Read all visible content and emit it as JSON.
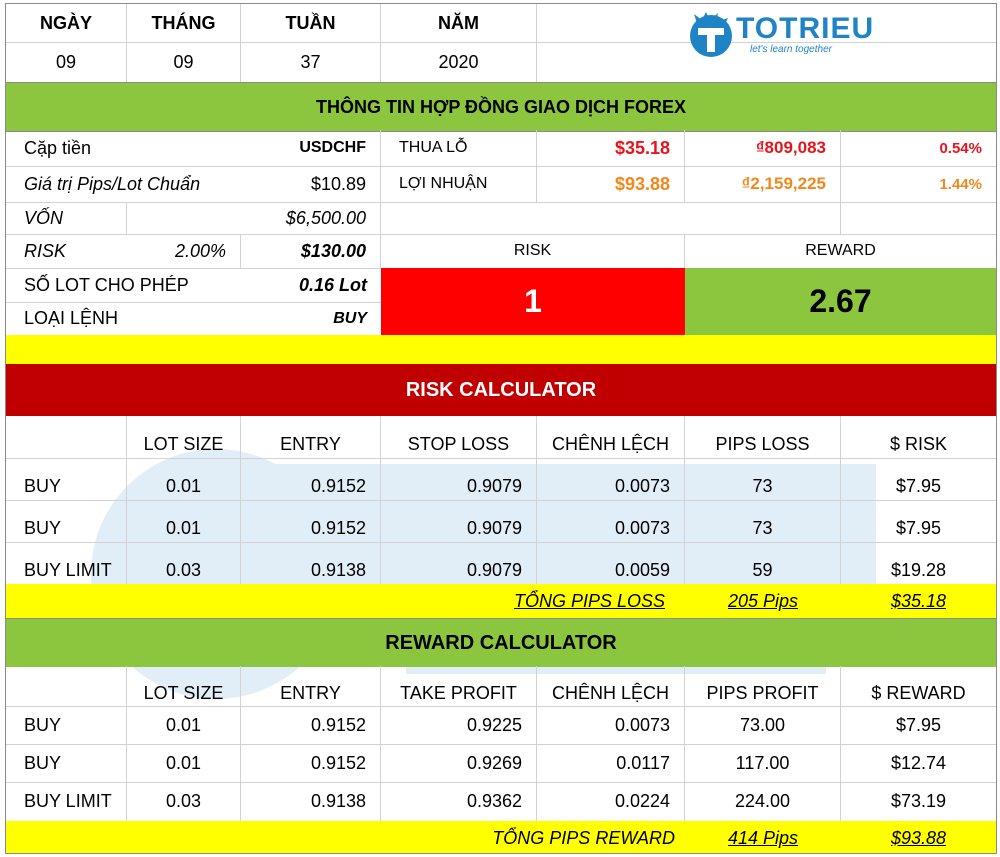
{
  "date_header": {
    "labels": [
      "NGÀY",
      "THÁNG",
      "TUẦN",
      "NĂM"
    ],
    "values": [
      "09",
      "09",
      "37",
      "2020"
    ]
  },
  "logo": {
    "name": "TOTRIEU",
    "tagline": "let's learn together",
    "icon": "totrieu-t-logo-icon",
    "color": "#1f84c6"
  },
  "contract_title": "THÔNG TIN HỢP ĐỒNG GIAO DỊCH FOREX",
  "contract": {
    "pair_label": "Cặp tiền",
    "pair_value": "USDCHF",
    "pip_label": "Giá trị Pips/Lot Chuẩn",
    "pip_value": "$10.89",
    "capital_label": "VỐN",
    "capital_value": "$6,500.00",
    "risk_label": "RISK",
    "risk_pct": "2.00%",
    "risk_value": "$130.00",
    "lot_label": "SỐ LOT CHO PHÉP",
    "lot_value": "0.16 Lot",
    "order_label": "LOẠI LỆNH",
    "order_value": "BUY",
    "loss_label": "THUA LỖ",
    "loss_usd": "$35.18",
    "loss_vnd": "₫809,083",
    "loss_pct": "0.54%",
    "profit_label": "LỢI NHUẬN",
    "profit_usd": "$93.88",
    "profit_vnd": "₫2,159,225",
    "profit_pct": "1.44%",
    "rr_risk_label": "RISK",
    "rr_reward_label": "REWARD",
    "rr_risk_value": "1",
    "rr_reward_value": "2.67"
  },
  "risk_calc": {
    "title": "RISK CALCULATOR",
    "headers": [
      "",
      "LOT SIZE",
      "ENTRY",
      "STOP LOSS",
      "CHÊNH LỆCH",
      "PIPS LOSS",
      "$ RISK"
    ],
    "rows": [
      [
        "BUY",
        "0.01",
        "0.9152",
        "0.9079",
        "0.0073",
        "73",
        "$7.95"
      ],
      [
        "BUY",
        "0.01",
        "0.9152",
        "0.9079",
        "0.0073",
        "73",
        "$7.95"
      ],
      [
        "BUY LIMIT",
        "0.03",
        "0.9138",
        "0.9079",
        "0.0059",
        "59",
        "$19.28"
      ]
    ],
    "total_label": "TỔNG PIPS LOSS",
    "total_pips": "205 Pips",
    "total_usd": "$35.18"
  },
  "reward_calc": {
    "title": "REWARD CALCULATOR",
    "headers": [
      "",
      "LOT SIZE",
      "ENTRY",
      "TAKE PROFIT",
      "CHÊNH LỆCH",
      "PIPS PROFIT",
      "$ REWARD"
    ],
    "rows": [
      [
        "BUY",
        "0.01",
        "0.9152",
        "0.9225",
        "0.0073",
        "73.00",
        "$7.95"
      ],
      [
        "BUY",
        "0.01",
        "0.9152",
        "0.9269",
        "0.0117",
        "117.00",
        "$12.74"
      ],
      [
        "BUY LIMIT",
        "0.03",
        "0.9138",
        "0.9362",
        "0.0224",
        "224.00",
        "$73.19"
      ]
    ],
    "total_label": "TỔNG PIPS REWARD",
    "total_pips": "414 Pips",
    "total_usd": "$93.88"
  },
  "colors": {
    "green": "#8cc63f",
    "yellow": "#ffff00",
    "red": "#ff0000",
    "dark_red": "#c00000",
    "loss_text": "#e8141c",
    "profit_text": "#f2881c"
  }
}
